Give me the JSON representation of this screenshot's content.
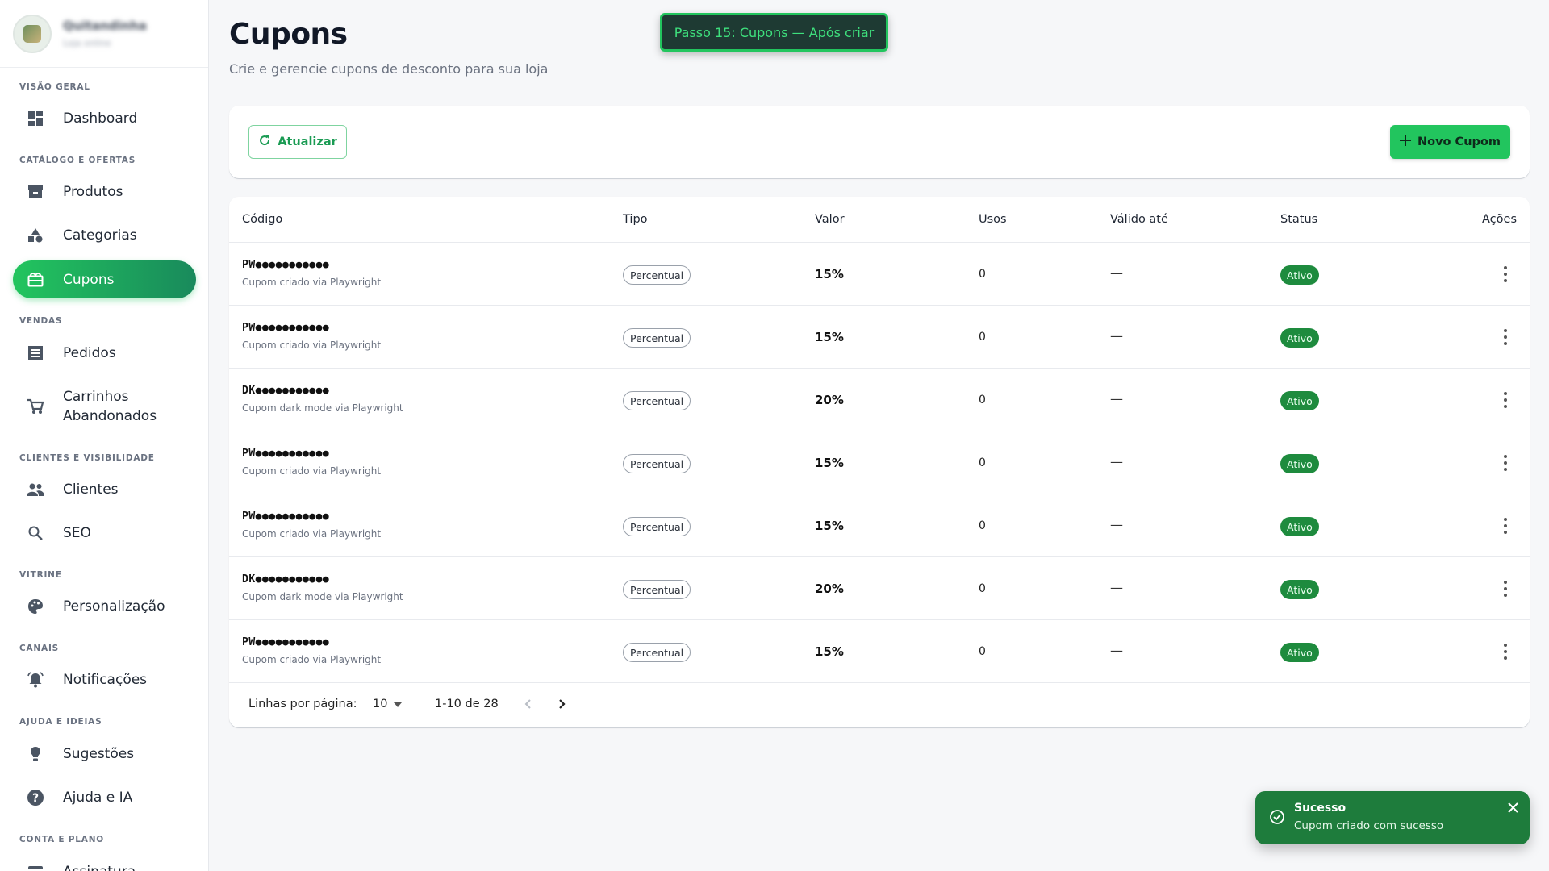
{
  "store": {
    "name": "Quitandinha",
    "subtitle": "Loja online"
  },
  "sidebar": {
    "sections": [
      "Visão geral",
      "Catálogo e ofertas",
      "Vendas",
      "Clientes e visibilidade",
      "Vitrine",
      "Canais",
      "Ajuda e ideias",
      "Conta e plano"
    ],
    "items": [
      {
        "label": "Dashboard",
        "icon": "dashboard-icon"
      },
      {
        "label": "Produtos",
        "icon": "archive-box-icon"
      },
      {
        "label": "Categorias",
        "icon": "shapes-icon"
      },
      {
        "label": "Cupons",
        "icon": "coupon-icon",
        "active": true
      },
      {
        "label": "Pedidos",
        "icon": "list-icon"
      },
      {
        "label": "Carrinhos Abandonados",
        "icon": "cart-icon"
      },
      {
        "label": "Clientes",
        "icon": "people-icon"
      },
      {
        "label": "SEO",
        "icon": "search-icon"
      },
      {
        "label": "Personalização",
        "icon": "palette-icon"
      },
      {
        "label": "Notificações",
        "icon": "bell-icon"
      },
      {
        "label": "Sugestões",
        "icon": "lightbulb-icon"
      },
      {
        "label": "Ajuda e IA",
        "icon": "help-icon"
      },
      {
        "label": "Assinatura",
        "icon": "card-icon"
      }
    ]
  },
  "header": {
    "title": "Cupons",
    "subtitle": "Crie e gerencie cupons de desconto para sua loja",
    "step_banner": "Passo 15: Cupons — Após criar"
  },
  "toolbar": {
    "refresh_label": "Atualizar",
    "new_label": "Novo Cupom"
  },
  "table": {
    "columns": [
      "Código",
      "Tipo",
      "Valor",
      "Usos",
      "Válido até",
      "Status",
      "Ações"
    ],
    "rows": [
      {
        "code": "PW●●●●●●●●●●●",
        "desc": "Cupom criado via Playwright",
        "type": "Percentual",
        "value": "15%",
        "uses": "0",
        "valid": "—",
        "status": "Ativo"
      },
      {
        "code": "PW●●●●●●●●●●●",
        "desc": "Cupom criado via Playwright",
        "type": "Percentual",
        "value": "15%",
        "uses": "0",
        "valid": "—",
        "status": "Ativo"
      },
      {
        "code": "DK●●●●●●●●●●●",
        "desc": "Cupom dark mode via Playwright",
        "type": "Percentual",
        "value": "20%",
        "uses": "0",
        "valid": "—",
        "status": "Ativo"
      },
      {
        "code": "PW●●●●●●●●●●●",
        "desc": "Cupom criado via Playwright",
        "type": "Percentual",
        "value": "15%",
        "uses": "0",
        "valid": "—",
        "status": "Ativo"
      },
      {
        "code": "PW●●●●●●●●●●●",
        "desc": "Cupom criado via Playwright",
        "type": "Percentual",
        "value": "15%",
        "uses": "0",
        "valid": "—",
        "status": "Ativo"
      },
      {
        "code": "DK●●●●●●●●●●●",
        "desc": "Cupom dark mode via Playwright",
        "type": "Percentual",
        "value": "20%",
        "uses": "0",
        "valid": "—",
        "status": "Ativo"
      },
      {
        "code": "PW●●●●●●●●●●●",
        "desc": "Cupom criado via Playwright",
        "type": "Percentual",
        "value": "15%",
        "uses": "0",
        "valid": "—",
        "status": "Ativo"
      }
    ]
  },
  "pagination": {
    "rows_label": "Linhas por página:",
    "rows_value": "10",
    "range": "1-10 de 28"
  },
  "toast": {
    "title": "Sucesso",
    "message": "Cupom criado com sucesso"
  },
  "colors": {
    "accent": "#22c55e",
    "accent_dark": "#198a5c",
    "status_active": "#1e8b3e",
    "toast_bg": "#1e7c3c"
  }
}
